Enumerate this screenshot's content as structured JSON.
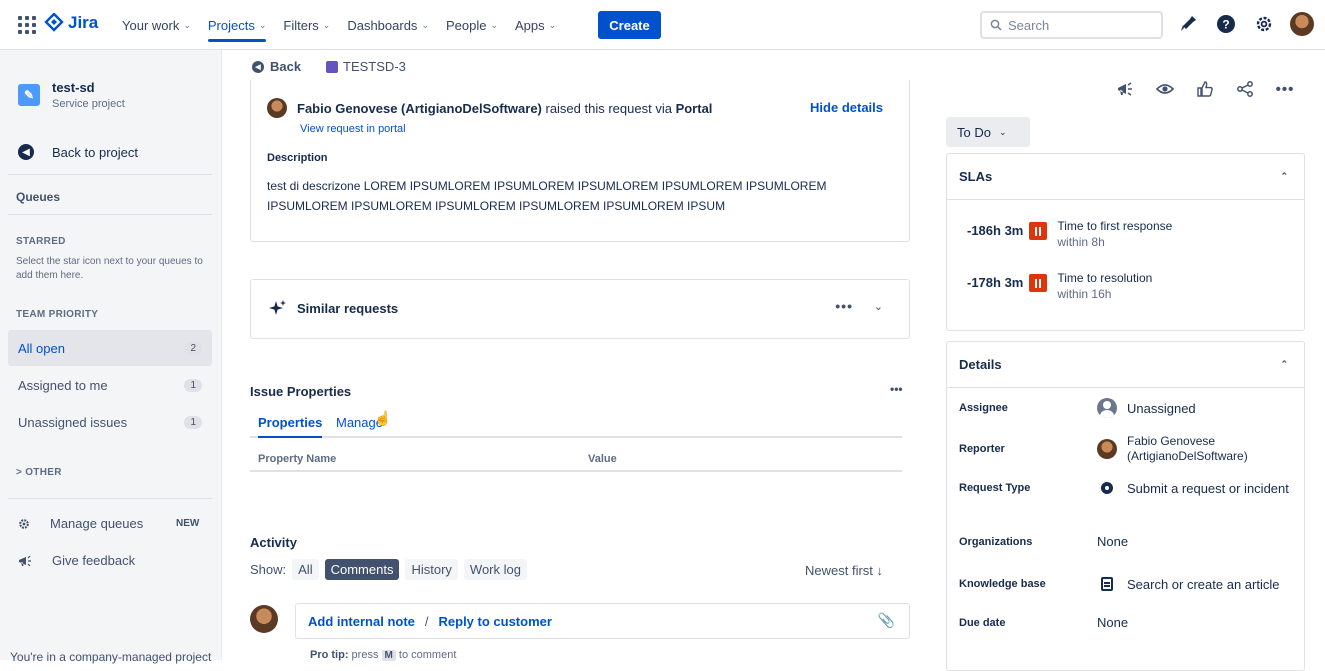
{
  "topbar": {
    "logo": "Jira",
    "nav": [
      {
        "label": "Your work",
        "chevron": "⌄"
      },
      {
        "label": "Projects",
        "chevron": "⌄"
      },
      {
        "label": "Filters",
        "chevron": "⌄"
      },
      {
        "label": "Dashboards",
        "chevron": "⌄"
      },
      {
        "label": "People",
        "chevron": "⌄"
      },
      {
        "label": "Apps",
        "chevron": "⌄"
      }
    ],
    "create": "Create",
    "search_placeholder": "Search"
  },
  "sidebar": {
    "project_name": "test-sd",
    "project_type": "Service project",
    "back": "Back to project",
    "queues": "Queues",
    "starred": "STARRED",
    "starred_hint": "Select the star icon next to your queues to add them here.",
    "team_priority": "TEAM PRIORITY",
    "items": [
      {
        "label": "All open",
        "count": "2"
      },
      {
        "label": "Assigned to me",
        "count": "1"
      },
      {
        "label": "Unassigned issues",
        "count": "1"
      }
    ],
    "other": "> OTHER",
    "manage_queues": "Manage queues",
    "new_badge": "NEW",
    "give_feedback": "Give feedback",
    "footer": "You're in a company-managed project"
  },
  "main": {
    "back": "Back",
    "ticket_key": "TESTSD-3",
    "raiser_name": "Fabio Genovese (ArtigianoDelSoftware)",
    "raiser_mid": " raised this request via ",
    "raiser_channel": "Portal",
    "hide_details": "Hide details",
    "view_portal": "View request in portal",
    "description_label": "Description",
    "description": "test di descrizone LOREM IPSUMLOREM IPSUMLOREM IPSUMLOREM IPSUMLOREM IPSUMLOREM IPSUMLOREM IPSUMLOREM IPSUMLOREM IPSUMLOREM IPSUMLOREM IPSUM",
    "similar": "Similar requests",
    "more": "•••",
    "issue_props": "Issue Properties",
    "props_more": "•••",
    "tab_properties": "Properties",
    "tab_manage": "Manage",
    "col_property": "Property Name",
    "col_value": "Value",
    "activity": "Activity",
    "show": "Show:",
    "filters": [
      "All",
      "Comments",
      "History",
      "Work log"
    ],
    "newest": "Newest first ↓",
    "add_note": "Add internal note",
    "slash": "/",
    "reply": "Reply to customer",
    "protip_label": "Pro tip:",
    "protip_press": " press ",
    "protip_key": "M",
    "protip_rest": " to comment"
  },
  "right": {
    "status": "To Do",
    "slas_title": "SLAs",
    "slas": [
      {
        "time": "-186h 3m",
        "name": "Time to first response",
        "within": "within 8h"
      },
      {
        "time": "-178h 3m",
        "name": "Time to resolution",
        "within": "within 16h"
      }
    ],
    "details_title": "Details",
    "details": [
      {
        "label": "Assignee",
        "value": "Unassigned"
      },
      {
        "label": "Reporter",
        "value": "Fabio Genovese (ArtigianoDelSoftware)"
      },
      {
        "label": "Request Type",
        "value": "Submit a request or incident"
      },
      {
        "label": "Organizations",
        "value": "None"
      },
      {
        "label": "Knowledge base",
        "value": "Search or create an article"
      },
      {
        "label": "Due date",
        "value": "None"
      }
    ]
  },
  "colors": {
    "brand": "#0052cc",
    "sla_breach": "#de350b",
    "sidebar_bg": "#f4f5f7"
  }
}
